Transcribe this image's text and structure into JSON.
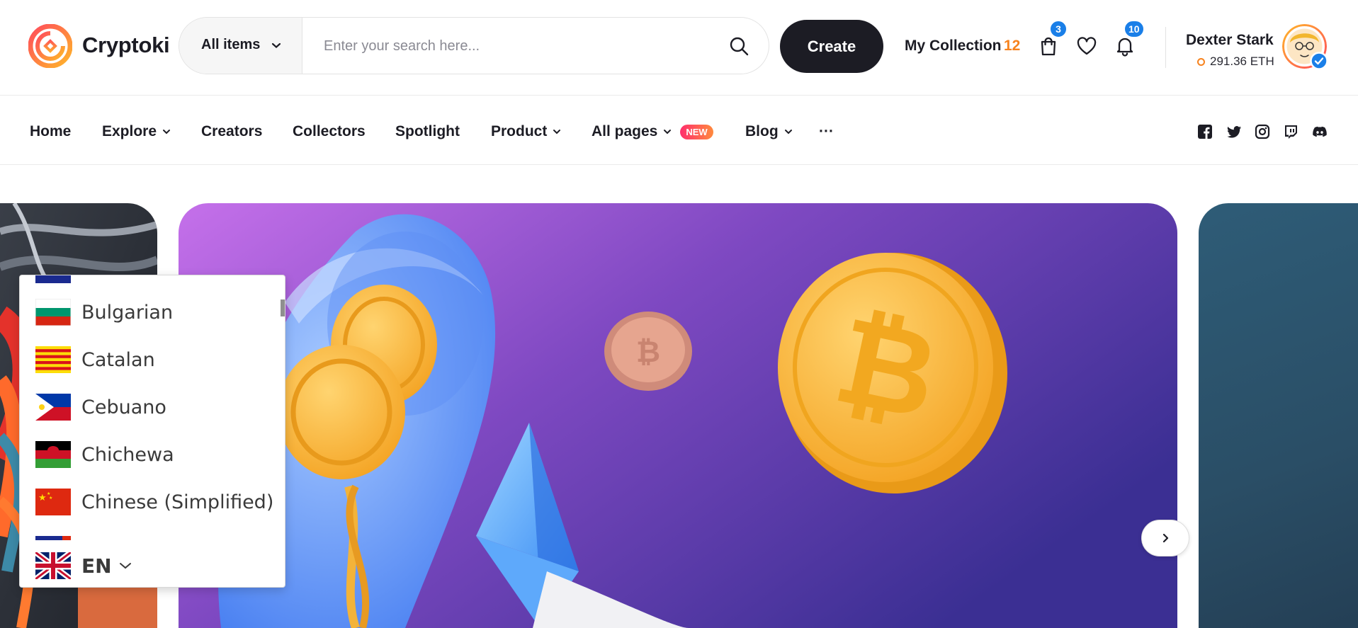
{
  "header": {
    "brand": "Cryptoki",
    "search": {
      "category": "All items",
      "placeholder": "Enter your search here..."
    },
    "create_label": "Create",
    "my_collection_label": "My Collection",
    "my_collection_count": "12",
    "cart_badge": "3",
    "notifications_badge": "10",
    "user": {
      "name": "Dexter Stark",
      "balance": "291.36 ETH"
    }
  },
  "nav": {
    "items": [
      "Home",
      "Explore",
      "Creators",
      "Collectors",
      "Spotlight",
      "Product",
      "All pages",
      "Blog",
      "···"
    ],
    "new_badge": "NEW"
  },
  "language_dropdown": {
    "items": [
      "Bulgarian",
      "Catalan",
      "Cebuano",
      "Chichewa",
      "Chinese (Simplified)"
    ],
    "current": "EN"
  },
  "colors": {
    "accent": "#f7831e",
    "dark": "#1c1c24",
    "badge_blue": "#1a7fe8"
  }
}
